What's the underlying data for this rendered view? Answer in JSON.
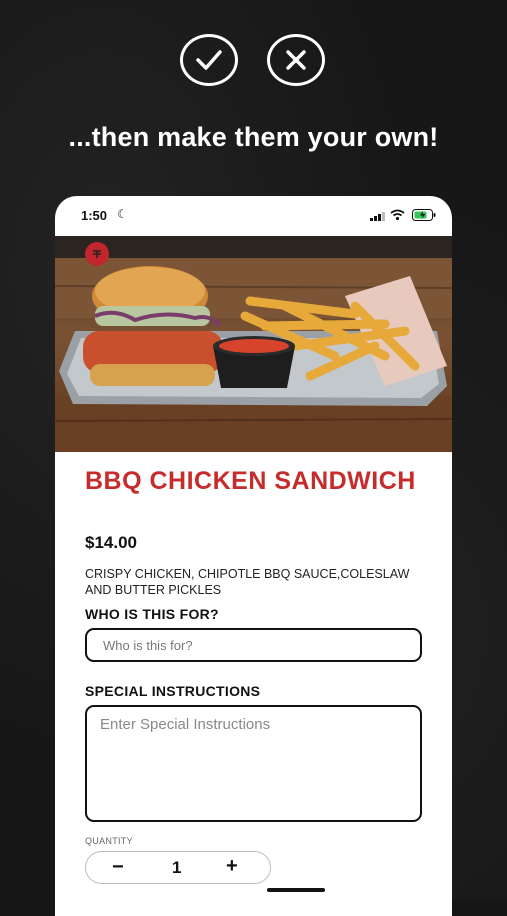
{
  "promo": {
    "headline": "...then make them your own!"
  },
  "status_bar": {
    "time": "1:50"
  },
  "item": {
    "title": "BBQ CHICKEN SANDWICH",
    "price": "$14.00",
    "description": "CRISPY CHICKEN, CHIPOTLE BBQ SAUCE,COLESLAW AND BUTTER PICKLES"
  },
  "who_for": {
    "label": "WHO IS THIS FOR?",
    "placeholder": "Who is this for?"
  },
  "special": {
    "label": "SPECIAL INSTRUCTIONS",
    "placeholder": "Enter Special Instructions"
  },
  "quantity": {
    "label": "QUANTITY",
    "value": "1",
    "minus": "−",
    "plus": "+"
  },
  "colors": {
    "accent": "#c62c2c",
    "background": "#171717"
  }
}
